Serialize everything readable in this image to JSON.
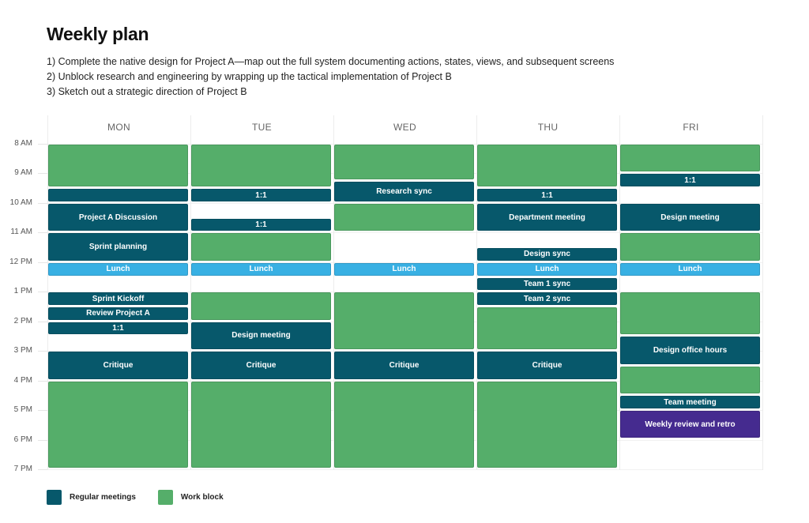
{
  "title": "Weekly plan",
  "goals": [
    "1) Complete the native design for Project A—map out the full system documenting actions, states, views, and subsequent screens",
    "2) Unblock research and engineering by wrapping up the tactical implementation of Project B",
    "3) Sketch out a strategic direction of Project B"
  ],
  "colors": {
    "meeting": "#07586b",
    "work": "#55ae6a",
    "lunch": "#38b0e3",
    "retro": "#452b8f"
  },
  "hours": [
    {
      "value": 8,
      "label": "8 AM"
    },
    {
      "value": 9,
      "label": "9 AM"
    },
    {
      "value": 10,
      "label": "10 AM"
    },
    {
      "value": 11,
      "label": "11 AM"
    },
    {
      "value": 12,
      "label": "12 PM"
    },
    {
      "value": 13,
      "label": "1 PM"
    },
    {
      "value": 14,
      "label": "2 PM"
    },
    {
      "value": 15,
      "label": "3 PM"
    },
    {
      "value": 16,
      "label": "4 PM"
    },
    {
      "value": 17,
      "label": "5 PM"
    },
    {
      "value": 18,
      "label": "6 PM"
    },
    {
      "value": 19,
      "label": "7 PM"
    }
  ],
  "days": [
    {
      "name": "MON",
      "events": [
        {
          "start": 8,
          "end": 9.5,
          "type": "work",
          "label": ""
        },
        {
          "start": 9.5,
          "end": 10,
          "type": "meeting",
          "label": ""
        },
        {
          "start": 10,
          "end": 11,
          "type": "meeting",
          "label": "Project A Discussion"
        },
        {
          "start": 11,
          "end": 12,
          "type": "meeting",
          "label": "Sprint planning"
        },
        {
          "start": 12,
          "end": 12.5,
          "type": "lunch",
          "label": "Lunch"
        },
        {
          "start": 13,
          "end": 13.5,
          "type": "meeting",
          "label": "Sprint Kickoff"
        },
        {
          "start": 13.5,
          "end": 14,
          "type": "meeting",
          "label": "Review Project A"
        },
        {
          "start": 14,
          "end": 14.5,
          "type": "meeting",
          "label": "1:1"
        },
        {
          "start": 15,
          "end": 16,
          "type": "meeting",
          "label": "Critique"
        },
        {
          "start": 16,
          "end": 19,
          "type": "work",
          "label": ""
        }
      ]
    },
    {
      "name": "TUE",
      "events": [
        {
          "start": 8,
          "end": 9.5,
          "type": "work",
          "label": ""
        },
        {
          "start": 9.5,
          "end": 10,
          "type": "meeting",
          "label": "1:1"
        },
        {
          "start": 10.5,
          "end": 11,
          "type": "meeting",
          "label": "1:1"
        },
        {
          "start": 11,
          "end": 12,
          "type": "work",
          "label": ""
        },
        {
          "start": 12,
          "end": 12.5,
          "type": "lunch",
          "label": "Lunch"
        },
        {
          "start": 13,
          "end": 14,
          "type": "work",
          "label": ""
        },
        {
          "start": 14,
          "end": 15,
          "type": "meeting",
          "label": "Design meeting"
        },
        {
          "start": 15,
          "end": 16,
          "type": "meeting",
          "label": "Critique"
        },
        {
          "start": 16,
          "end": 19,
          "type": "work",
          "label": ""
        }
      ]
    },
    {
      "name": "WED",
      "events": [
        {
          "start": 8,
          "end": 9.25,
          "type": "work",
          "label": ""
        },
        {
          "start": 9.25,
          "end": 10,
          "type": "meeting",
          "label": "Research sync"
        },
        {
          "start": 10,
          "end": 11,
          "type": "work",
          "label": ""
        },
        {
          "start": 12,
          "end": 12.5,
          "type": "lunch",
          "label": "Lunch"
        },
        {
          "start": 13,
          "end": 15,
          "type": "work",
          "label": ""
        },
        {
          "start": 15,
          "end": 16,
          "type": "meeting",
          "label": "Critique"
        },
        {
          "start": 16,
          "end": 19,
          "type": "work",
          "label": ""
        }
      ]
    },
    {
      "name": "THU",
      "events": [
        {
          "start": 8,
          "end": 9.5,
          "type": "work",
          "label": ""
        },
        {
          "start": 9.5,
          "end": 10,
          "type": "meeting",
          "label": "1:1"
        },
        {
          "start": 10,
          "end": 11,
          "type": "meeting",
          "label": "Department meeting"
        },
        {
          "start": 11.5,
          "end": 12,
          "type": "meeting",
          "label": "Design sync"
        },
        {
          "start": 12,
          "end": 12.5,
          "type": "lunch",
          "label": "Lunch"
        },
        {
          "start": 12.5,
          "end": 13,
          "type": "meeting",
          "label": "Team 1 sync"
        },
        {
          "start": 13,
          "end": 13.5,
          "type": "meeting",
          "label": "Team 2 sync"
        },
        {
          "start": 13.5,
          "end": 15,
          "type": "work",
          "label": ""
        },
        {
          "start": 15,
          "end": 16,
          "type": "meeting",
          "label": "Critique"
        },
        {
          "start": 16,
          "end": 19,
          "type": "work",
          "label": ""
        }
      ]
    },
    {
      "name": "FRI",
      "events": [
        {
          "start": 8,
          "end": 9,
          "type": "work",
          "label": ""
        },
        {
          "start": 9,
          "end": 9.5,
          "type": "meeting",
          "label": "1:1"
        },
        {
          "start": 10,
          "end": 11,
          "type": "meeting",
          "label": "Design meeting"
        },
        {
          "start": 11,
          "end": 12,
          "type": "work",
          "label": ""
        },
        {
          "start": 12,
          "end": 12.5,
          "type": "lunch",
          "label": "Lunch"
        },
        {
          "start": 13,
          "end": 14.5,
          "type": "work",
          "label": ""
        },
        {
          "start": 14.5,
          "end": 15.5,
          "type": "meeting",
          "label": "Design office hours"
        },
        {
          "start": 15.5,
          "end": 16.5,
          "type": "work",
          "label": ""
        },
        {
          "start": 16.5,
          "end": 17,
          "type": "meeting",
          "label": "Team meeting"
        },
        {
          "start": 17,
          "end": 18,
          "type": "retro",
          "label": "Weekly review and retro"
        }
      ]
    }
  ],
  "legend": [
    {
      "label": "Regular meetings",
      "type": "meeting"
    },
    {
      "label": "Work block",
      "type": "work"
    }
  ]
}
